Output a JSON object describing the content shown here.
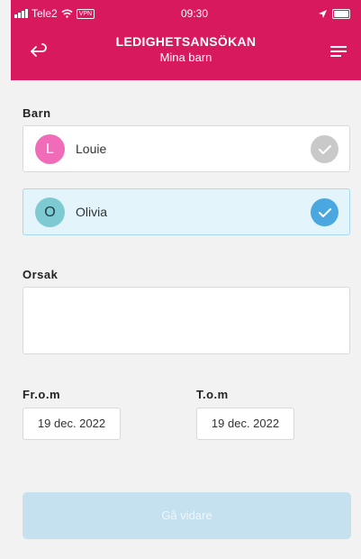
{
  "status_bar": {
    "carrier": "Tele2",
    "vpn": "VPN",
    "time": "09:30"
  },
  "header": {
    "title": "LEDIGHETSANSÖKAN",
    "subtitle": "Mina barn",
    "back_icon": "back-arrow-icon",
    "menu_icon": "hamburger-menu-icon"
  },
  "children": {
    "label": "Barn",
    "items": [
      {
        "initial": "L",
        "name": "Louie",
        "selected": false,
        "avatar_color": "#f06bb8",
        "check_color": "#c9c9c9"
      },
      {
        "initial": "O",
        "name": "Olivia",
        "selected": true,
        "avatar_color": "#7dcad3",
        "check_color": "#4aa7e0"
      }
    ]
  },
  "reason": {
    "label": "Orsak",
    "value": ""
  },
  "dates": {
    "from_label": "Fr.o.m",
    "from_value": "19 dec. 2022",
    "to_label": "T.o.m",
    "to_value": "19 dec. 2022"
  },
  "next_button": {
    "label": "Gå vidare",
    "disabled": true
  },
  "colors": {
    "brand": "#d9195e",
    "selected_bg": "#e3f4fb",
    "button_disabled": "#c5e0ee"
  }
}
